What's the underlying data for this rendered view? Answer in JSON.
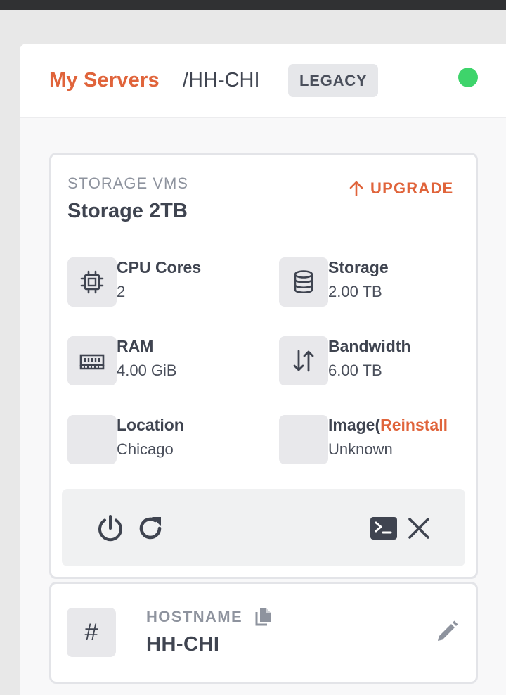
{
  "header": {
    "breadcrumb_link": "My Servers",
    "breadcrumb_current": "/HH-CHI",
    "badge": "LEGACY",
    "status_color": "#3ed46b"
  },
  "card": {
    "eyebrow": "STORAGE VMS",
    "title": "Storage 2TB",
    "upgrade_label": "UPGRADE",
    "specs": {
      "cpu": {
        "label": "CPU Cores",
        "value": "2",
        "icon": "cpu-icon"
      },
      "storage": {
        "label": "Storage",
        "value": "2.00 TB",
        "icon": "database-icon"
      },
      "ram": {
        "label": "RAM",
        "value": "4.00 GiB",
        "icon": "memory-icon"
      },
      "bandwidth": {
        "label": "Bandwidth",
        "value": "6.00 TB",
        "icon": "transfer-arrows-icon"
      },
      "location": {
        "label": "Location",
        "value": "Chicago"
      },
      "image": {
        "label": "Image(",
        "link": "Reinstall",
        "value": "Unknown"
      }
    },
    "actions": [
      "power-icon",
      "restart-icon",
      "console-icon",
      "close-icon"
    ]
  },
  "hostname": {
    "label": "HOSTNAME",
    "value": "HH-CHI",
    "icon": "#"
  },
  "colors": {
    "accent": "#e0643b",
    "text": "#3f4450",
    "muted": "#8e939e"
  }
}
